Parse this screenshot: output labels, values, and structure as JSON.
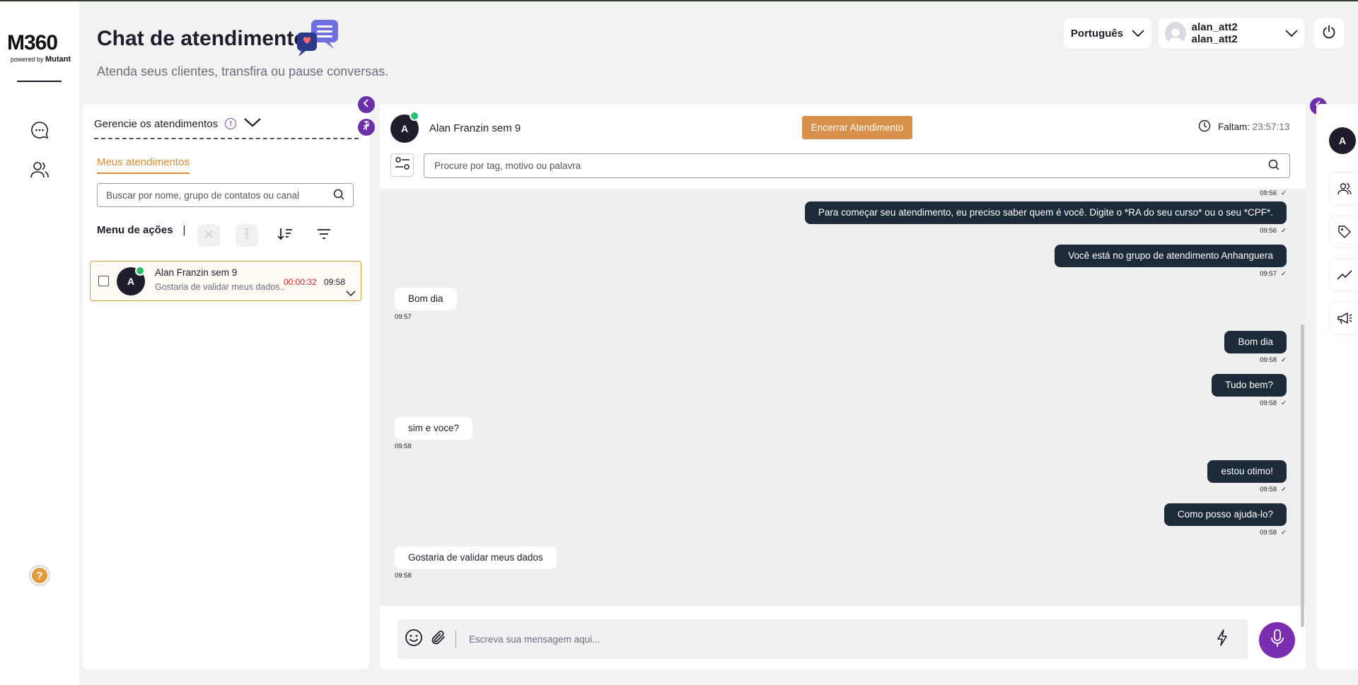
{
  "app": {
    "logo_main": "M360",
    "logo_powered": "powered by",
    "logo_brand": "Mutant"
  },
  "header": {
    "title": "Chat de atendimento",
    "subtitle": "Atenda seus clientes, transfira ou pause conversas.",
    "language": "Português",
    "user_name": "alan_att2 alan_att2"
  },
  "left_panel": {
    "manage_label": "Gerencie os atendimentos",
    "tab_label": "Meus atendimentos",
    "search_placeholder": "Buscar por nome, grupo de contatos ou canal",
    "actions_label": "Menu de ações",
    "actions_separator": "|",
    "chats": [
      {
        "avatar": "A",
        "name": "Alan Franzin sem 9",
        "preview": "Gostaria de validar meus dados..",
        "timer": "00:00:32",
        "time": "09:58"
      }
    ]
  },
  "chat": {
    "avatar": "A",
    "contact_name": "Alan Franzin sem 9",
    "end_button": "Encerrar Atendimento",
    "remaining_label": "Faltam:",
    "remaining_value": "23:57:13",
    "search_placeholder": "Procure por tag, motivo ou palavra",
    "top_partial_time": "09:56",
    "messages": [
      {
        "dir": "out",
        "text": "Para começar seu atendimento, eu preciso saber quem é você. Digite o *RA do seu curso* ou o seu *CPF*.",
        "time": "09:56"
      },
      {
        "dir": "out",
        "text": "Você está no grupo de atendimento Anhanguera",
        "time": "09:57"
      },
      {
        "dir": "in",
        "text": "Bom dia",
        "time": "09:57"
      },
      {
        "dir": "out",
        "text": "Bom dia",
        "time": "09:58"
      },
      {
        "dir": "out",
        "text": "Tudo bem?",
        "time": "09:58"
      },
      {
        "dir": "in",
        "text": "sim e voce?",
        "time": "09:58"
      },
      {
        "dir": "out",
        "text": "estou otimo!",
        "time": "09:58"
      },
      {
        "dir": "out",
        "text": "Como posso ajuda-lo?",
        "time": "09:58"
      },
      {
        "dir": "in",
        "text": "Gostaria de validar meus dados",
        "time": "09:58"
      }
    ],
    "composer_placeholder": "Escreva sua mensagem aqui..."
  },
  "right_bar": {
    "avatar": "A"
  },
  "colors": {
    "accent_purple": "#6b2fa8",
    "accent_orange": "#d8914a",
    "dark_bubble": "#1d2a3a",
    "timer_red": "#e02424",
    "whatsapp_green": "#25c16f"
  },
  "icons": [
    "chat-bubble-icon",
    "users-icon",
    "help-icon",
    "chevron-down-icon",
    "power-icon",
    "search-icon",
    "sort-icon",
    "filter-icon",
    "clock-icon",
    "emoji-icon",
    "attach-icon",
    "lightning-icon",
    "microphone-icon",
    "tag-icon",
    "trending-icon",
    "megaphone-icon"
  ]
}
